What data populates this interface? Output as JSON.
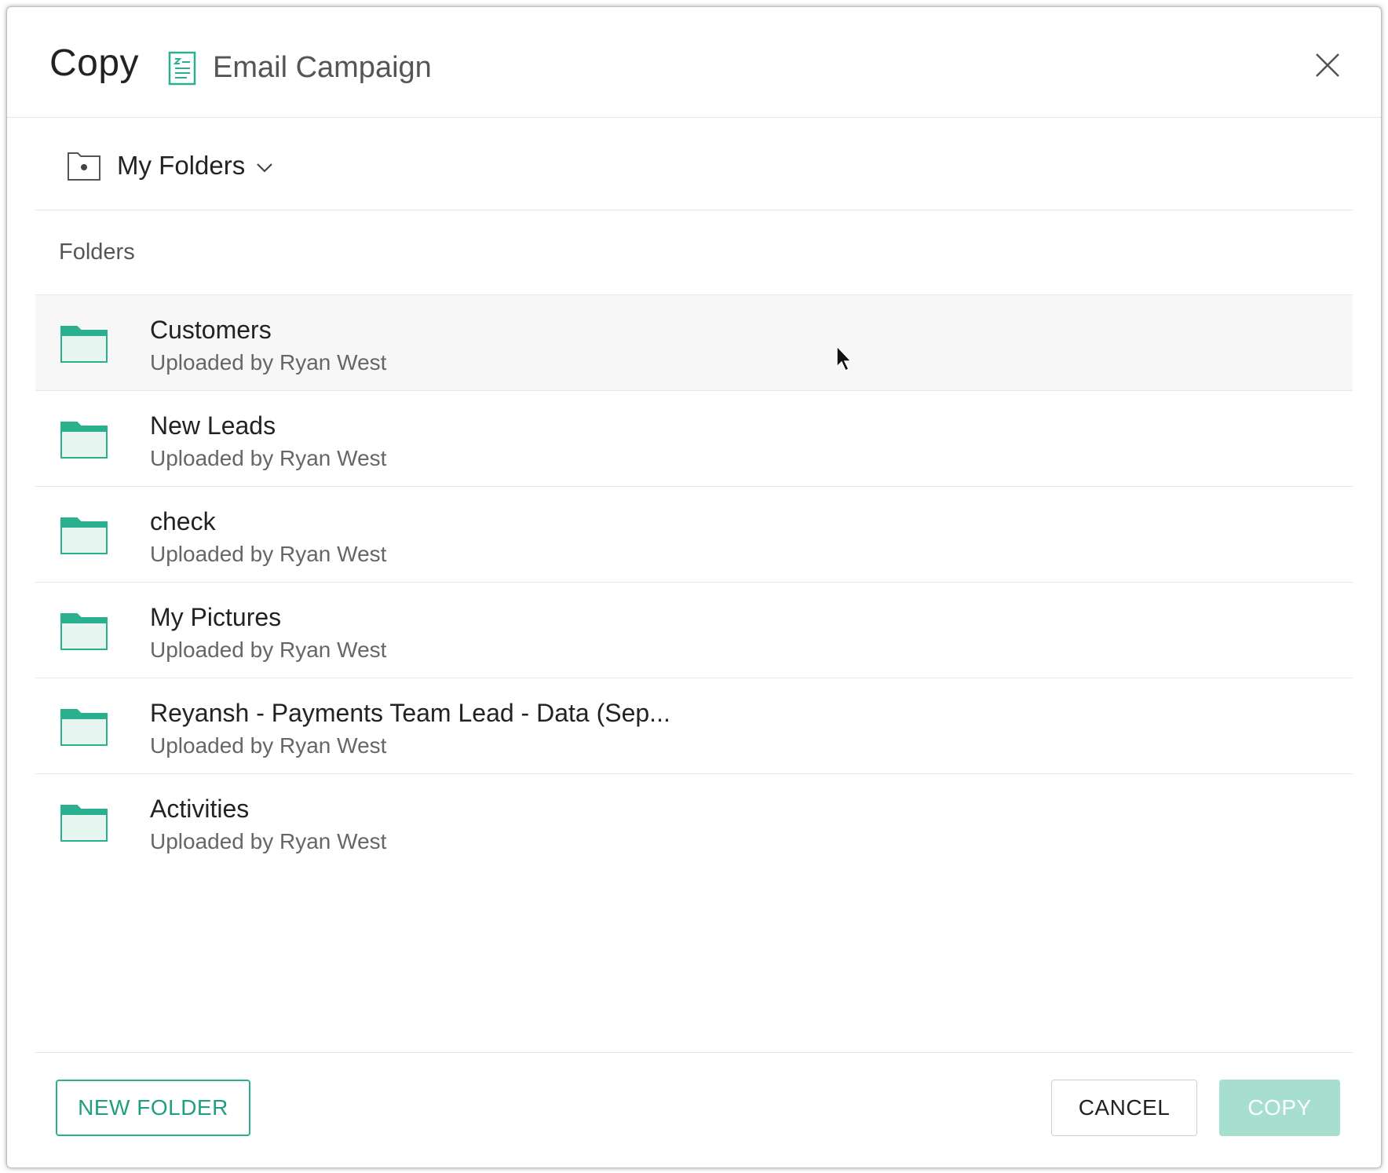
{
  "dialog": {
    "title": "Copy",
    "item_name": "Email Campaign",
    "item_icon": "document-icon",
    "close_icon": "close-icon"
  },
  "location": {
    "label": "My Folders",
    "icon": "folder-root-icon",
    "chevron": "chevron-down-icon"
  },
  "section_label": "Folders",
  "folders": [
    {
      "name": "Customers",
      "meta": "Uploaded by Ryan West"
    },
    {
      "name": "New Leads",
      "meta": "Uploaded by Ryan West"
    },
    {
      "name": "check",
      "meta": "Uploaded by Ryan West"
    },
    {
      "name": "My Pictures",
      "meta": "Uploaded by Ryan West"
    },
    {
      "name": "Reyansh - Payments Team Lead - Data (Sep...",
      "meta": "Uploaded by Ryan West"
    },
    {
      "name": "Activities",
      "meta": "Uploaded by Ryan West"
    }
  ],
  "footer": {
    "new_folder_label": "NEW FOLDER",
    "cancel_label": "CANCEL",
    "copy_label": "COPY"
  },
  "colors": {
    "accent": "#2bb08f",
    "folder_fill": "#e6f5f0",
    "copy_disabled": "#a6dfd0"
  }
}
